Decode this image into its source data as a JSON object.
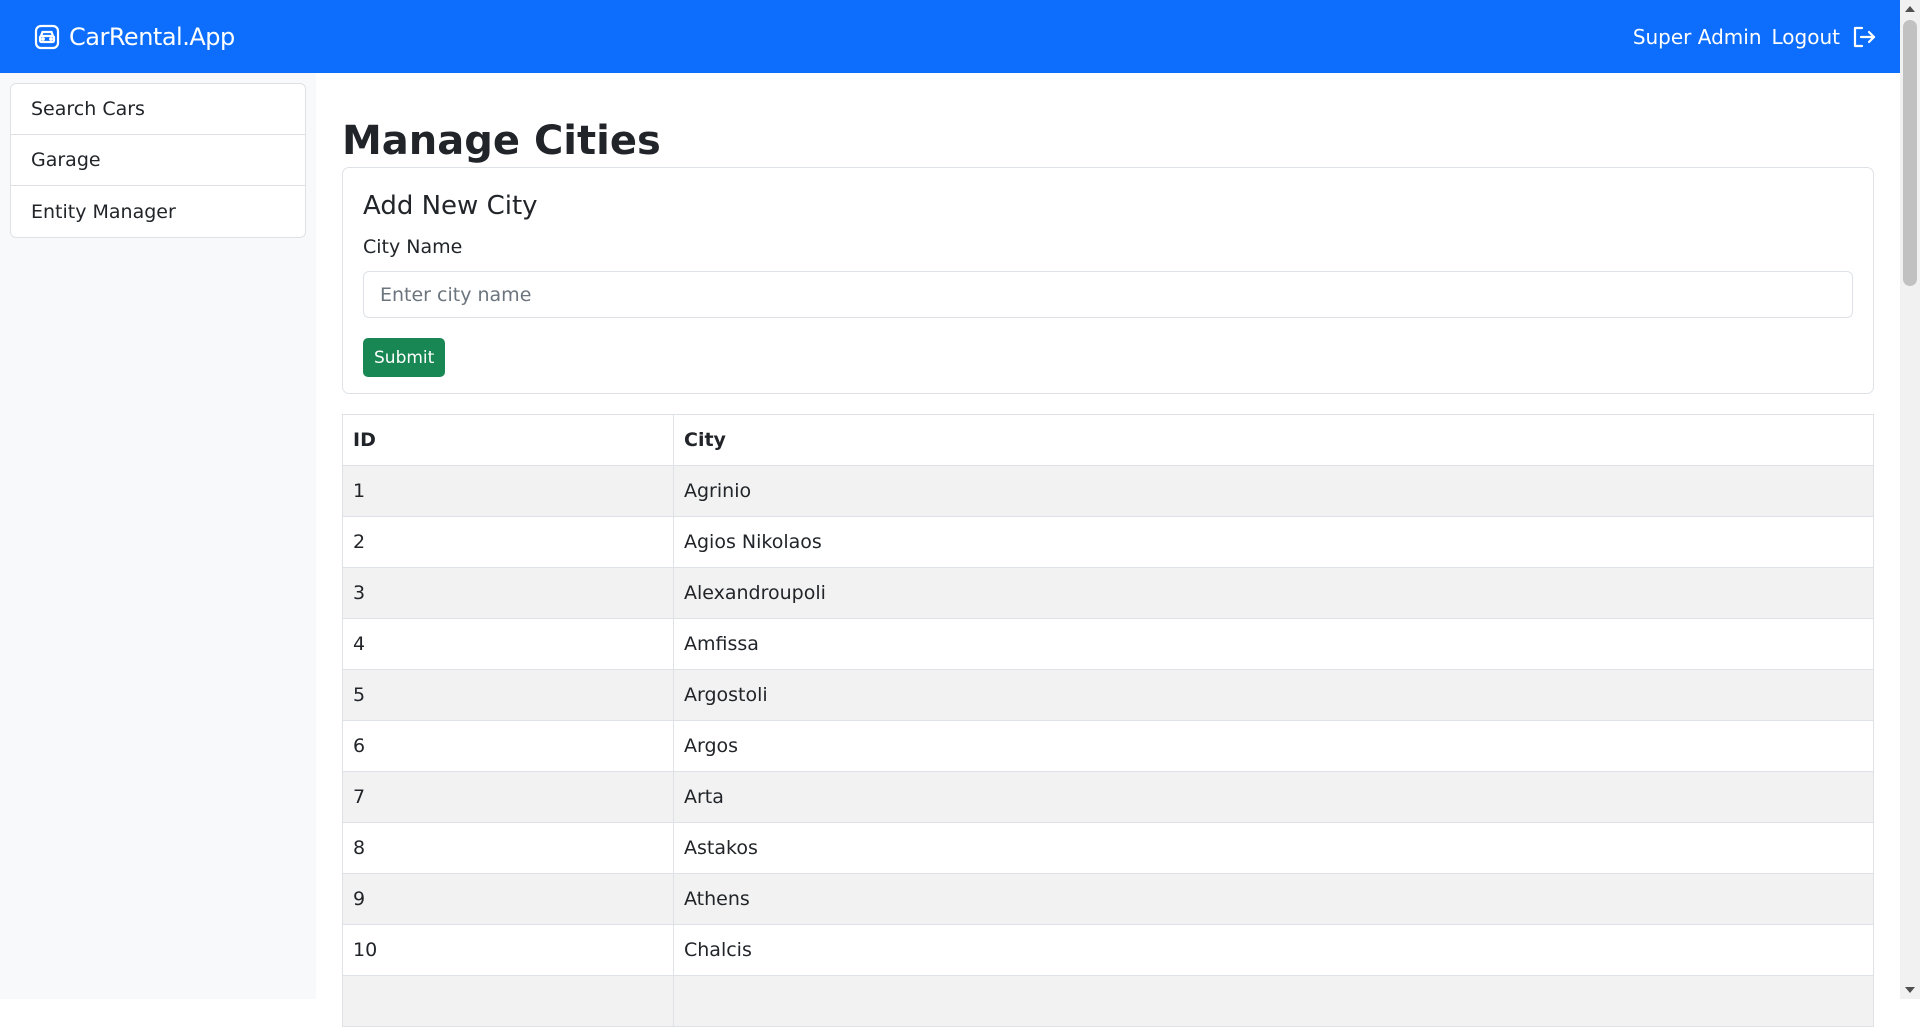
{
  "navbar": {
    "brand": "CarRental.App",
    "user": "Super Admin",
    "logout_label": "Logout"
  },
  "sidebar": {
    "items": [
      {
        "label": "Search Cars"
      },
      {
        "label": "Garage"
      },
      {
        "label": "Entity Manager"
      }
    ]
  },
  "main": {
    "title": "Manage Cities",
    "form": {
      "title": "Add New City",
      "label": "City Name",
      "placeholder": "Enter city name",
      "value": "",
      "submit_label": "Submit"
    },
    "table": {
      "headers": [
        "ID",
        "City"
      ],
      "rows": [
        [
          "1",
          "Agrinio"
        ],
        [
          "2",
          "Agios Nikolaos"
        ],
        [
          "3",
          "Alexandroupoli"
        ],
        [
          "4",
          "Amfissa"
        ],
        [
          "5",
          "Argostoli"
        ],
        [
          "6",
          "Argos"
        ],
        [
          "7",
          "Arta"
        ],
        [
          "8",
          "Astakos"
        ],
        [
          "9",
          "Athens"
        ],
        [
          "10",
          "Chalcis"
        ],
        [
          "",
          ""
        ]
      ]
    }
  },
  "colors": {
    "navbar_bg": "#0d6efd",
    "submit_bg": "#198754",
    "sidebar_bg": "#f8f9fa",
    "row_stripe": "#f2f2f2"
  },
  "icons": {
    "brand": "car-front-icon",
    "logout": "box-arrow-right-icon"
  }
}
